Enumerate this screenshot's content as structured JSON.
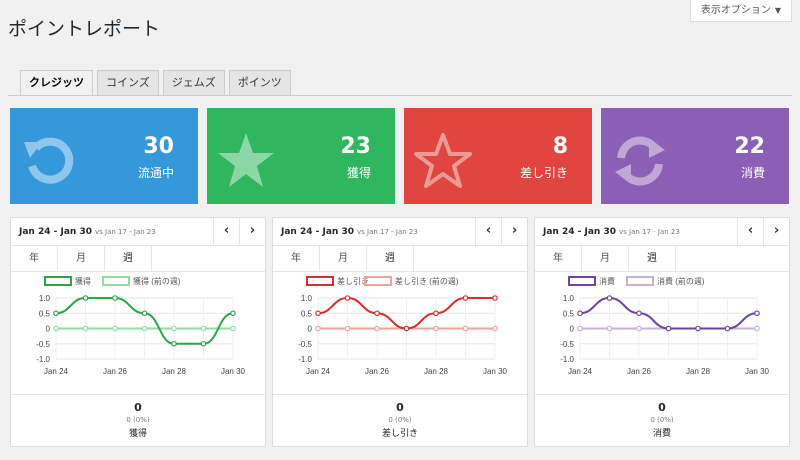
{
  "page": {
    "title": "ポイントレポート",
    "screen_options": "表示オプション"
  },
  "tabs": [
    "クレジッツ",
    "コインズ",
    "ジェムズ",
    "ポインツ"
  ],
  "cards": [
    {
      "value": "30",
      "label": "流通中",
      "color": "#3498db",
      "icon": "refresh-arrow-icon"
    },
    {
      "value": "23",
      "label": "獲得",
      "color": "#2fb65f",
      "icon": "star-icon"
    },
    {
      "value": "8",
      "label": "差し引き",
      "color": "#e0463f",
      "icon": "star-outline-icon"
    },
    {
      "value": "22",
      "label": "消費",
      "color": "#8a5fb5",
      "icon": "sync-icon"
    }
  ],
  "panels": [
    {
      "range": "Jan 24 - Jan 30",
      "vs": "vs Jan 17 - Jan 23",
      "periods": [
        "年",
        "月",
        "週"
      ],
      "footer": {
        "value": "0",
        "pct": "0 (0%)",
        "label": "獲得"
      }
    },
    {
      "range": "Jan 24 - Jan 30",
      "vs": "vs Jan 17 - Jan 23",
      "periods": [
        "年",
        "月",
        "週"
      ],
      "footer": {
        "value": "0",
        "pct": "0 (0%)",
        "label": "差し引き"
      }
    },
    {
      "range": "Jan 24 - Jan 30",
      "vs": "vs Jan 17 - Jan 23",
      "periods": [
        "年",
        "月",
        "週"
      ],
      "footer": {
        "value": "0",
        "pct": "0 (0%)",
        "label": "消費"
      }
    }
  ],
  "chart_data": [
    {
      "type": "line",
      "x": [
        "Jan 24",
        "Jan 25",
        "Jan 26",
        "Jan 27",
        "Jan 28",
        "Jan 29",
        "Jan 30"
      ],
      "xticks": [
        "Jan 24",
        "Jan 26",
        "Jan 28",
        "Jan 30"
      ],
      "yticks": [
        "1.0",
        "0.5",
        "0",
        "-0.5",
        "-1.0"
      ],
      "ylim": [
        -1,
        1
      ],
      "series": [
        {
          "name": "獲得",
          "color": "#2aa549",
          "values": [
            0.5,
            1.0,
            1.0,
            0.5,
            -0.5,
            -0.5,
            0.5
          ]
        },
        {
          "name": "獲得 (前の週)",
          "color": "#90dca2",
          "values": [
            0,
            0,
            0,
            0,
            0,
            0,
            0
          ]
        }
      ]
    },
    {
      "type": "line",
      "x": [
        "Jan 24",
        "Jan 25",
        "Jan 26",
        "Jan 27",
        "Jan 28",
        "Jan 29",
        "Jan 30"
      ],
      "xticks": [
        "Jan 24",
        "Jan 26",
        "Jan 28",
        "Jan 30"
      ],
      "yticks": [
        "1.0",
        "0.5",
        "0",
        "-0.5",
        "-1.0"
      ],
      "ylim": [
        -1,
        1
      ],
      "series": [
        {
          "name": "差し引き",
          "color": "#d9302b",
          "values": [
            0.5,
            1.0,
            0.5,
            0,
            0.5,
            1.0,
            1.0
          ]
        },
        {
          "name": "差し引き (前の週)",
          "color": "#f2a09a",
          "values": [
            0,
            0,
            0,
            0,
            0,
            0,
            0
          ]
        }
      ]
    },
    {
      "type": "line",
      "x": [
        "Jan 24",
        "Jan 25",
        "Jan 26",
        "Jan 27",
        "Jan 28",
        "Jan 29",
        "Jan 30"
      ],
      "xticks": [
        "Jan 24",
        "Jan 26",
        "Jan 28",
        "Jan 30"
      ],
      "yticks": [
        "1.0",
        "0.5",
        "0",
        "-0.5",
        "-1.0"
      ],
      "ylim": [
        -1,
        1
      ],
      "series": [
        {
          "name": "消費",
          "color": "#6e44a8",
          "values": [
            0.5,
            1.0,
            0.5,
            0,
            0,
            0,
            0.5
          ]
        },
        {
          "name": "消費 (前の週)",
          "color": "#c5b0e0",
          "values": [
            0,
            0,
            0,
            0,
            0,
            0,
            0
          ]
        }
      ]
    }
  ]
}
